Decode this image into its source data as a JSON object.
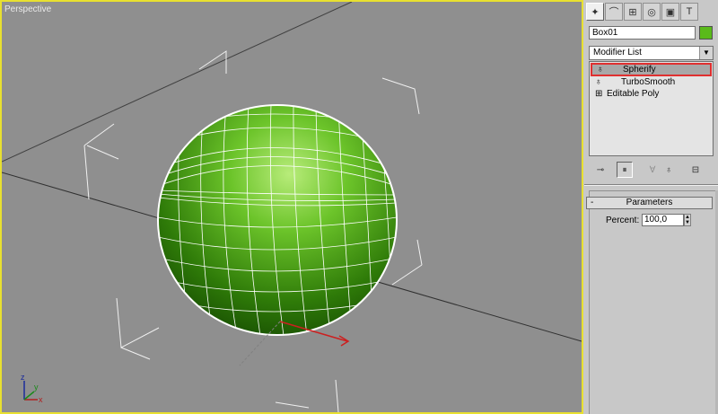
{
  "viewport": {
    "label": "Perspective",
    "object_color": "#5aba1a",
    "wire_color": "#ffffff",
    "bg_color": "#8f8f8f",
    "axis_labels": {
      "z": "z",
      "x": "x",
      "y": "y"
    }
  },
  "command_panel": {
    "tabs": [
      {
        "name": "create-tab",
        "icon": "cursor-star-icon"
      },
      {
        "name": "modify-tab",
        "icon": "modify-bend-icon"
      },
      {
        "name": "hierarchy-tab",
        "icon": "hierarchy-icon"
      },
      {
        "name": "motion-tab",
        "icon": "motion-icon"
      },
      {
        "name": "display-tab",
        "icon": "display-monitor-icon"
      },
      {
        "name": "utilities-tab",
        "icon": "hammer-icon"
      }
    ],
    "object_name": "Box01",
    "modifier_list": "Modifier List",
    "stack": [
      {
        "label": "Spherify",
        "selected": true,
        "icon": "lightbulb-icon"
      },
      {
        "label": "TurboSmooth",
        "selected": false,
        "icon": "lightbulb-icon"
      },
      {
        "label": "Editable Poly",
        "selected": false,
        "icon": "plus-box-icon"
      }
    ],
    "stack_tools": [
      "pin-stack-icon",
      "show-end-result-icon",
      "make-unique-icon",
      "remove-modifier-icon",
      "configure-sets-icon"
    ],
    "parameters": {
      "title": "Parameters",
      "collapse": "-",
      "percent_label": "Percent:",
      "percent_value": "100,0"
    }
  }
}
